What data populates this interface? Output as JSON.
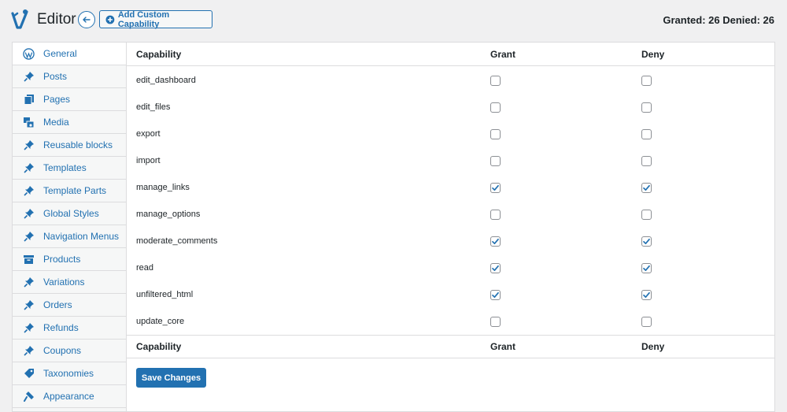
{
  "header": {
    "title": "Editor",
    "add_button_label": "Add Custom Capability",
    "counts": "Granted: 26 Denied: 26"
  },
  "sidebar": {
    "items": [
      {
        "label": "General",
        "icon": "wordpress-icon"
      },
      {
        "label": "Posts",
        "icon": "pin-icon"
      },
      {
        "label": "Pages",
        "icon": "pages-icon"
      },
      {
        "label": "Media",
        "icon": "media-icon"
      },
      {
        "label": "Reusable blocks",
        "icon": "pin-icon"
      },
      {
        "label": "Templates",
        "icon": "pin-icon"
      },
      {
        "label": "Template Parts",
        "icon": "pin-icon"
      },
      {
        "label": "Global Styles",
        "icon": "pin-icon"
      },
      {
        "label": "Navigation Menus",
        "icon": "pin-icon"
      },
      {
        "label": "Products",
        "icon": "archive-icon"
      },
      {
        "label": "Variations",
        "icon": "pin-icon"
      },
      {
        "label": "Orders",
        "icon": "pin-icon"
      },
      {
        "label": "Refunds",
        "icon": "pin-icon"
      },
      {
        "label": "Coupons",
        "icon": "pin-icon"
      },
      {
        "label": "Taxonomies",
        "icon": "tag-icon"
      },
      {
        "label": "Appearance",
        "icon": "brush-icon"
      }
    ]
  },
  "table": {
    "col_capability": "Capability",
    "col_grant": "Grant",
    "col_deny": "Deny",
    "rows": [
      {
        "name": "edit_dashboard",
        "grant": false,
        "deny": false
      },
      {
        "name": "edit_files",
        "grant": false,
        "deny": false
      },
      {
        "name": "export",
        "grant": false,
        "deny": false
      },
      {
        "name": "import",
        "grant": false,
        "deny": false
      },
      {
        "name": "manage_links",
        "grant": true,
        "deny": true
      },
      {
        "name": "manage_options",
        "grant": false,
        "deny": false
      },
      {
        "name": "moderate_comments",
        "grant": true,
        "deny": true
      },
      {
        "name": "read",
        "grant": true,
        "deny": true
      },
      {
        "name": "unfiltered_html",
        "grant": true,
        "deny": true
      },
      {
        "name": "update_core",
        "grant": false,
        "deny": false
      }
    ]
  },
  "save_label": "Save Changes",
  "colors": {
    "accent": "#2271b1",
    "background": "#f0f0f1",
    "border": "#dcdcde"
  }
}
